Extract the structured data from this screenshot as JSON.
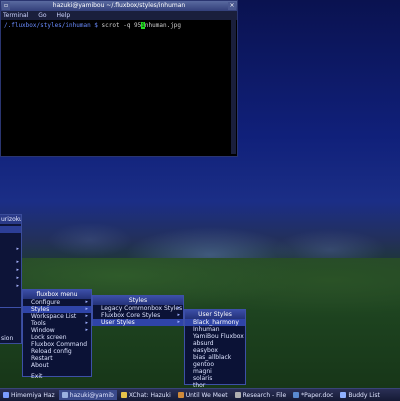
{
  "terminal": {
    "title": "hazuki@yamibou ~/.fluxbox/styles/inhuman",
    "menu": [
      "Terminal",
      "Go",
      "Help"
    ],
    "prompt": "/.fluxbox/styles/inhuman $",
    "command_before_cursor": " scrot -q 95",
    "cursor_char": "i",
    "command_after_cursor": "nhuman.jpg"
  },
  "left_menu": {
    "title": "urizoku",
    "visible_fragment": "sion"
  },
  "fluxbox_menu": {
    "title": "fluxbox menu",
    "items": [
      "Configure",
      "Styles",
      "Workspace List",
      "Tools",
      "Window",
      "Lock screen",
      "Fluxbox Command",
      "Reload config",
      "Restart",
      "About"
    ],
    "exit_label": "Exit",
    "selected": "Styles"
  },
  "styles_menu": {
    "title": "Styles",
    "items": [
      "Legacy Commonbox Styles",
      "Fluxbox Core Styles",
      "User Styles"
    ],
    "selected": "User Styles"
  },
  "user_styles_menu": {
    "title": "User Styles",
    "items": [
      "Black_harmony",
      "Inhuman",
      "YamiBou Fluxbox",
      "absurd",
      "easybox",
      "bias_allblack",
      "gentoo",
      "magni",
      "solaris",
      "thor"
    ],
    "selected": "Black_harmony"
  },
  "taskbar": {
    "tasks": [
      {
        "label": "Himemiya Haz",
        "color": "#7a9cff",
        "active": false
      },
      {
        "label": "hazuki@yamib",
        "color": "#9ab0e0",
        "active": true
      },
      {
        "label": "XChat: Hazuki",
        "color": "#e6c24a",
        "active": false
      },
      {
        "label": "Until We Meet",
        "color": "#d08a3a",
        "active": false
      },
      {
        "label": "Research - File",
        "color": "#b0b0b0",
        "active": false
      },
      {
        "label": "*Paper.doc",
        "color": "#5a8ad0",
        "active": false
      },
      {
        "label": "Buddy List",
        "color": "#8fb0ff",
        "active": false
      }
    ]
  }
}
